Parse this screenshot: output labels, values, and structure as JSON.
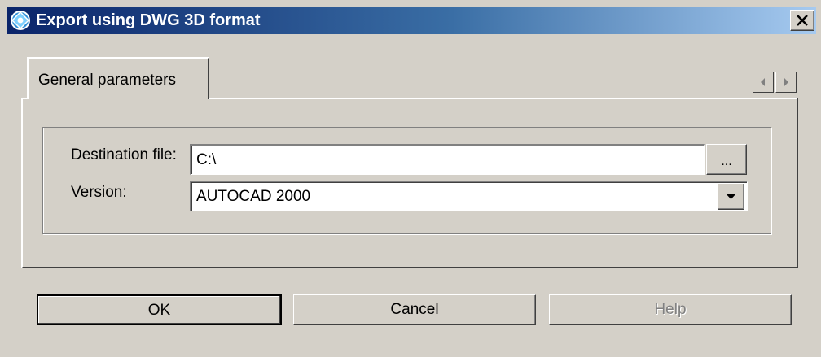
{
  "window": {
    "title": "Export using DWG 3D format"
  },
  "tabs": [
    {
      "label": "General parameters"
    }
  ],
  "form": {
    "destination_label": "Destination file:",
    "destination_value": "C:\\",
    "browse_label": "...",
    "version_label": "Version:",
    "version_value": "AUTOCAD 2000"
  },
  "buttons": {
    "ok": "OK",
    "cancel": "Cancel",
    "help": "Help"
  },
  "colors": {
    "titlebar_start": "#0a246a",
    "titlebar_end": "#a6caf0",
    "face": "#d4d0c8"
  }
}
